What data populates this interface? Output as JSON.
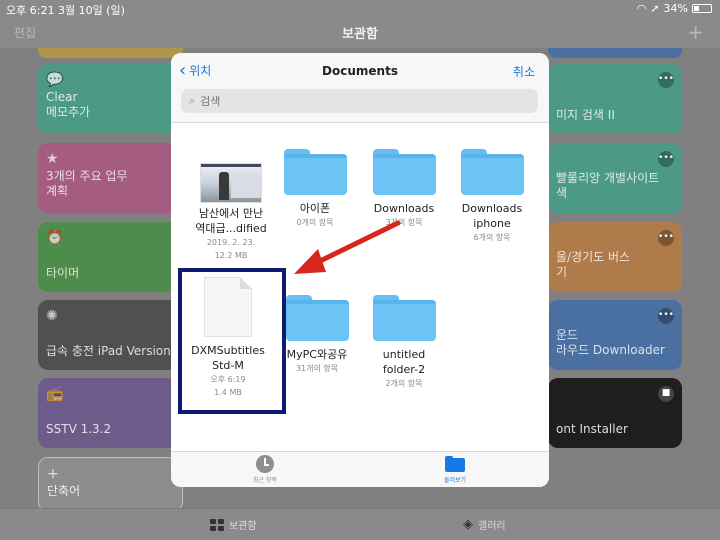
{
  "status": {
    "time": "오후 6:21",
    "date": "3월 10일 (일)",
    "battery": "34%",
    "battery_level": 0.34
  },
  "nav": {
    "edit": "편집",
    "title": "보관함",
    "add": "+"
  },
  "tiles": {
    "clear": "Clear\n메모추가",
    "top3": "3개의 주요 업무\n계획",
    "timer": "타이머",
    "charge": "급속 충전 iPad Version",
    "sstv": "SSTV 1.3.2",
    "shortcut": "단축어",
    "image_search": "미지 검색 II",
    "bbulry": "빨룰리앙 개별사이트\n색",
    "bus": "울/경기도 버스\n기",
    "sound": "운드\n라우드 Downloader",
    "font": "ont Installer"
  },
  "tabbar": {
    "library": "보관함",
    "gallery": "갤러리"
  },
  "modal": {
    "back": "위치",
    "title": "Documents",
    "cancel": "취소",
    "search_placeholder": "검색",
    "items": [
      {
        "name": "남산에서 만난\n역대급...dified",
        "sub1": "2019. 2. 23.",
        "sub2": "12.2 MB"
      },
      {
        "name": "아이폰",
        "sub1": "0개의 항목"
      },
      {
        "name": "Downloads",
        "sub1": "3개의 항목"
      },
      {
        "name": "Downloads\niphone",
        "sub1": "6개의 항목"
      },
      {
        "name": "DXMSubtitles\nStd-M",
        "sub1": "오후 6:19",
        "sub2": "1.4 MB"
      },
      {
        "name": "MyPC와공유",
        "sub1": "31개의 항목"
      },
      {
        "name": "untitled\nfolder-2",
        "sub1": "2개의 항목"
      }
    ],
    "tabs": {
      "recent": "최근 항목",
      "browse": "둘러보기"
    }
  },
  "colors": {
    "accent": "#1779e6",
    "highlight_box": "#0c1c73",
    "arrow": "#d7261b",
    "folder": "#6cc4f6"
  }
}
